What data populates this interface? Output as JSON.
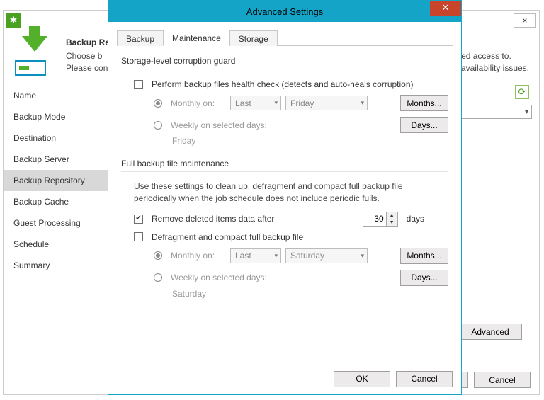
{
  "back": {
    "header": {
      "title": "Backup Repository",
      "desc_part1": "Choose b",
      "desc_part2": "nted access to. Please contact y",
      "desc_part3": "y availability issues."
    },
    "sidebar": {
      "items": [
        {
          "label": "Name"
        },
        {
          "label": "Backup Mode"
        },
        {
          "label": "Destination"
        },
        {
          "label": "Backup Server"
        },
        {
          "label": "Backup Repository"
        },
        {
          "label": "Backup Cache"
        },
        {
          "label": "Guest Processing"
        },
        {
          "label": "Schedule"
        },
        {
          "label": "Summary"
        }
      ],
      "active_index": 4
    },
    "footer": {
      "advanced": "Advanced",
      "finish_partial": "h",
      "cancel": "Cancel"
    }
  },
  "dialog": {
    "title": "Advanced Settings",
    "tabs": [
      {
        "label": "Backup"
      },
      {
        "label": "Maintenance"
      },
      {
        "label": "Storage"
      }
    ],
    "active_tab": 1,
    "guard": {
      "section": "Storage-level corruption guard",
      "health_check": "Perform backup files health check (detects and auto-heals corruption)",
      "monthly": "Monthly on:",
      "weekly": "Weekly on selected days:",
      "sel_occurrence": "Last",
      "sel_day": "Friday",
      "months_btn": "Months...",
      "days_btn": "Days...",
      "weekly_value": "Friday"
    },
    "full": {
      "section": "Full backup file maintenance",
      "desc": "Use these settings to clean up, defragment and compact full backup file periodically when the job schedule does not include periodic fulls.",
      "remove": "Remove deleted items data after",
      "days_value": "30",
      "days_word": "days",
      "defrag": "Defragment and compact full backup file",
      "monthly": "Monthly on:",
      "sel_occurrence": "Last",
      "sel_day": "Saturday",
      "months_btn": "Months...",
      "weekly": "Weekly on selected days:",
      "days_btn": "Days...",
      "weekly_value": "Saturday"
    },
    "footer": {
      "ok": "OK",
      "cancel": "Cancel"
    }
  }
}
